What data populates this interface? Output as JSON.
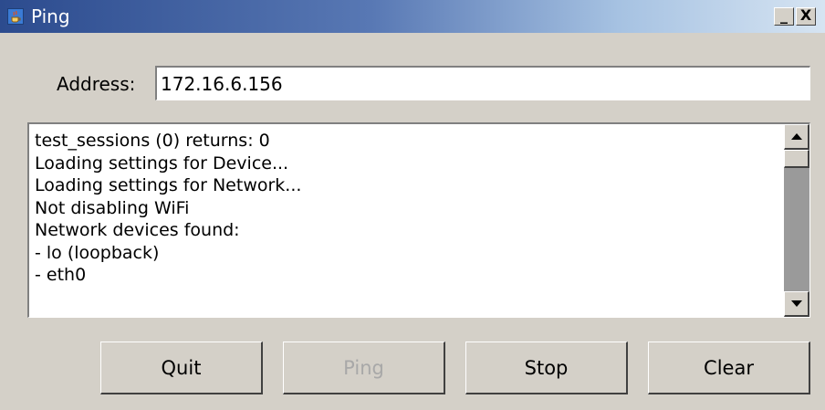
{
  "window": {
    "title": "Ping",
    "app_icon": "java-cup-icon",
    "controls": {
      "minimize_label": "_",
      "close_label": "X"
    }
  },
  "address": {
    "label": "Address:",
    "value": "172.16.6.156"
  },
  "log": {
    "lines": [
      "test_sessions (0) returns: 0",
      "Loading settings for Device...",
      "Loading settings for Network...",
      "Not disabling WiFi",
      "Network devices found:",
      "- lo (loopback)",
      "- eth0"
    ]
  },
  "buttons": {
    "quit": "Quit",
    "ping": "Ping",
    "stop": "Stop",
    "clear": "Clear"
  }
}
